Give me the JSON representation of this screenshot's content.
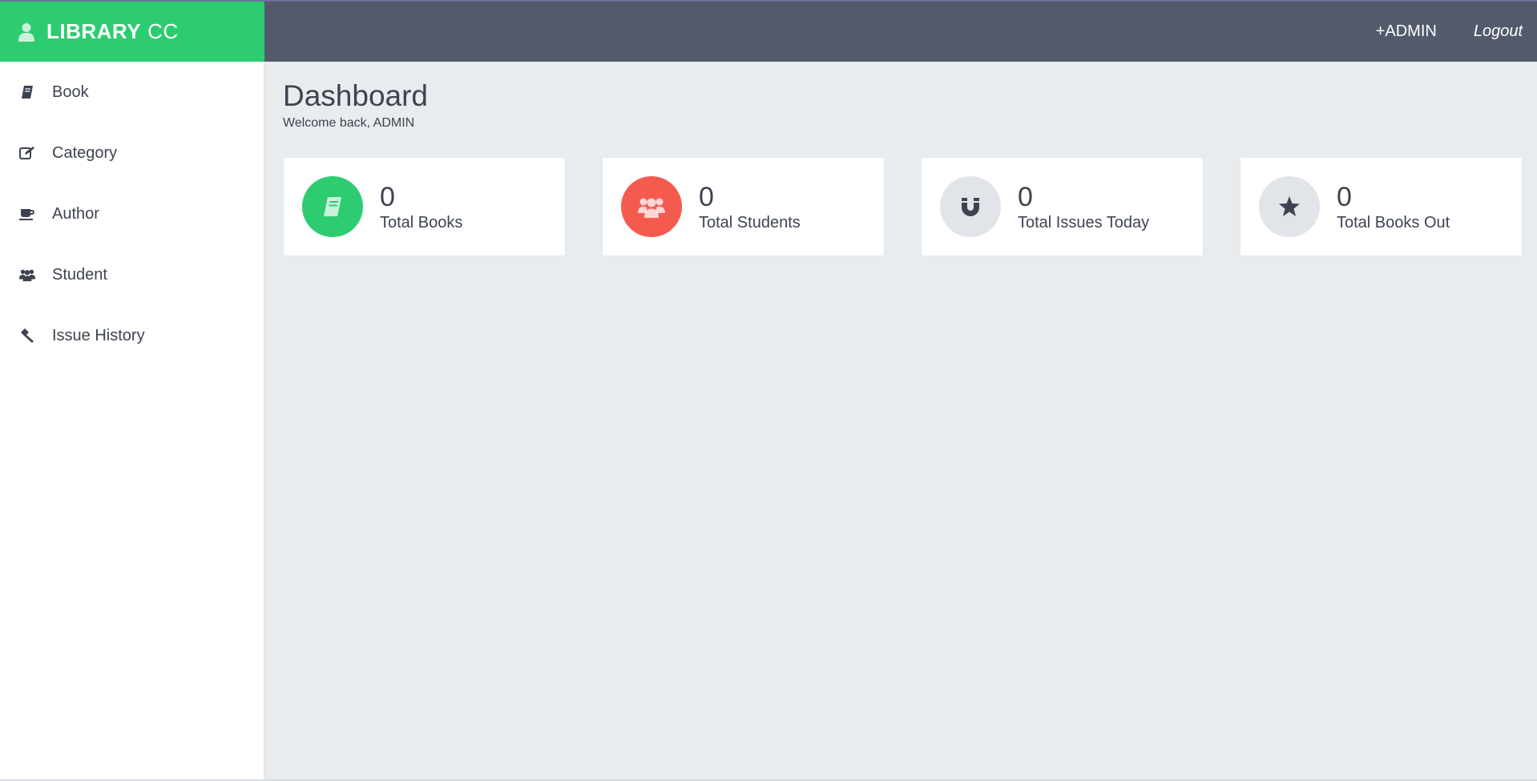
{
  "brand": {
    "strong": "LIBRARY",
    "light": "CC",
    "icon": "user-icon"
  },
  "topbar": {
    "admin_link": "+ADMIN",
    "logout_link": "Logout"
  },
  "sidebar": {
    "items": [
      {
        "label": "Book",
        "icon": "book-icon"
      },
      {
        "label": "Category",
        "icon": "edit-icon"
      },
      {
        "label": "Author",
        "icon": "coffee-icon"
      },
      {
        "label": "Student",
        "icon": "users-icon"
      },
      {
        "label": "Issue History",
        "icon": "gavel-icon"
      }
    ]
  },
  "main": {
    "title": "Dashboard",
    "subtitle": "Welcome back, ADMIN",
    "cards": [
      {
        "value": "0",
        "label": "Total Books",
        "icon": "book-icon",
        "color": "#2ecc71"
      },
      {
        "value": "0",
        "label": "Total Students",
        "icon": "users-icon",
        "color": "#f55a4e"
      },
      {
        "value": "0",
        "label": "Total Issues Today",
        "icon": "magnet-icon",
        "color": "#e1e4e9"
      },
      {
        "value": "0",
        "label": "Total Books Out",
        "icon": "star-icon",
        "color": "#e1e4e9"
      }
    ]
  },
  "colors": {
    "accent": "#2ecc71",
    "topbar": "#535a6b",
    "background": "#e9ecef",
    "danger": "#f55a4e"
  }
}
